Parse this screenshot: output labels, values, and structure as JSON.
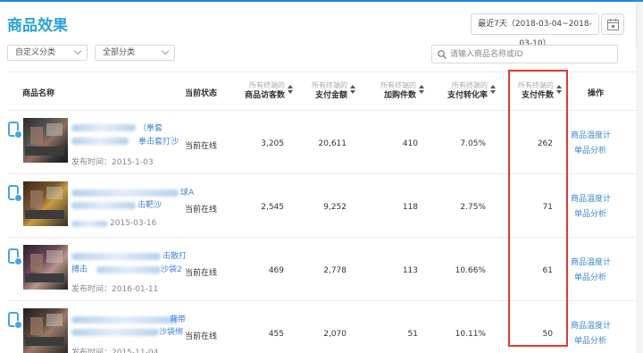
{
  "header": {
    "title": "商品效果",
    "date_range": "最近7天（2018-03-04~2018-03-10）"
  },
  "filters": {
    "custom_category": "自定义分类",
    "all_category": "全部分类",
    "search_placeholder": "请输入商品名称或ID"
  },
  "columns": {
    "product_name": "商品名称",
    "status": "当前状态",
    "visitors": {
      "sub": "所有终端的",
      "main": "商品访客数"
    },
    "amount": {
      "sub": "所有终端的",
      "main": "支付金额"
    },
    "cart": {
      "sub": "所有终端的",
      "main": "加购件数"
    },
    "conversion": {
      "sub": "所有终端的",
      "main": "支付转化率"
    },
    "paid_items": {
      "sub": "所有终端的",
      "main": "支付件数"
    },
    "actions": "操作"
  },
  "rows": [
    {
      "title_fragment_1": "（拳套",
      "title_fragment_2": "拳击套打沙",
      "publish": "发布时间：2015-1-03",
      "status": "当前在线",
      "visitors": "3,205",
      "amount": "20,611",
      "cart": "410",
      "conversion": "7.05%",
      "paid_items": "262",
      "action_1": "商品温度计",
      "action_2": "单品分析"
    },
    {
      "title_fragment_1": "球A",
      "title_fragment_2": "击靶沙",
      "publish": "2015-03-16",
      "status": "当前在线",
      "visitors": "2,545",
      "amount": "9,252",
      "cart": "118",
      "conversion": "2.75%",
      "paid_items": "71",
      "action_1": "商品温度计",
      "action_2": "单品分析"
    },
    {
      "title_fragment_1": "击散打",
      "title_fragment_2": "搏击",
      "title_fragment_3": "沙袋2",
      "publish": "发布时间：2016-01-11",
      "status": "当前在线",
      "visitors": "469",
      "amount": "2,778",
      "cart": "113",
      "conversion": "10.66%",
      "paid_items": "61",
      "action_1": "商品温度计",
      "action_2": "单品分析"
    },
    {
      "title_fragment_1": "背带",
      "title_fragment_2": "沙袋绑",
      "publish": "发布时间：2015-11-04",
      "status": "当前在线",
      "visitors": "455",
      "amount": "2,070",
      "cart": "51",
      "conversion": "10.11%",
      "paid_items": "50",
      "action_1": "商品温度计",
      "action_2": "单品分析"
    }
  ]
}
